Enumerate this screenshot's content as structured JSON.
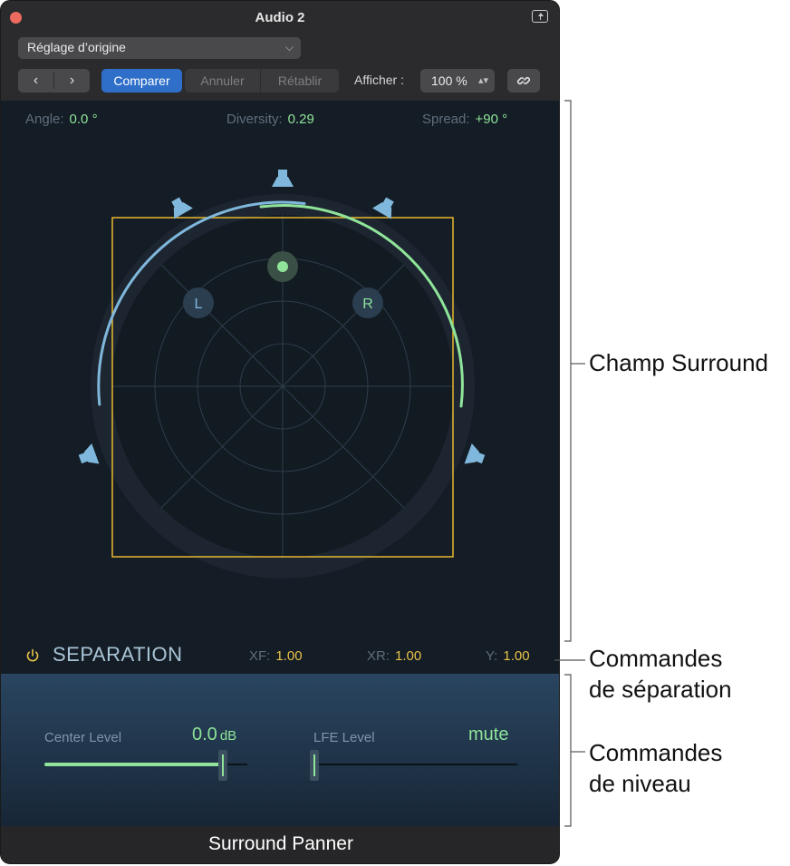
{
  "window": {
    "title": "Audio 2",
    "plugin_name": "Surround Panner"
  },
  "toolbar": {
    "preset": "Réglage d’origine",
    "back_glyph": "‹",
    "forward_glyph": "›",
    "compare": "Comparer",
    "undo": "Annuler",
    "redo": "Rétablir",
    "show_label": "Afficher :",
    "zoom": "100 %"
  },
  "params": {
    "angle_label": "Angle:",
    "angle_value": "0.0 °",
    "diversity_label": "Diversity:",
    "diversity_value": "0.29",
    "spread_label": "Spread:",
    "spread_value": "+90 °"
  },
  "field": {
    "left_label": "L",
    "right_label": "R"
  },
  "separation": {
    "title": "SEPARATION",
    "xf_label": "XF:",
    "xf_value": "1.00",
    "xr_label": "XR:",
    "xr_value": "1.00",
    "y_label": "Y:",
    "y_value": "1.00"
  },
  "levels": {
    "center_label": "Center Level",
    "center_value": "0.0",
    "center_unit": "dB",
    "center_fraction": 0.88,
    "lfe_label": "LFE Level",
    "lfe_value": "mute",
    "lfe_fraction": 0.0
  },
  "callouts": {
    "surround_field": "Champ Surround",
    "separation_line1": "Commandes",
    "separation_line2": "de séparation",
    "level_line1": "Commandes",
    "level_line2": "de niveau"
  },
  "colors": {
    "accent_green": "#8fe49a",
    "accent_blue": "#7fb8dc",
    "separation_yellow": "#e8c348",
    "compare_blue": "#2f6fc9"
  },
  "icons": [
    "close-dot",
    "share-icon",
    "chevron-down-icon",
    "chevron-left-icon",
    "chevron-right-icon",
    "link-icon",
    "power-icon",
    "speaker-icon"
  ]
}
